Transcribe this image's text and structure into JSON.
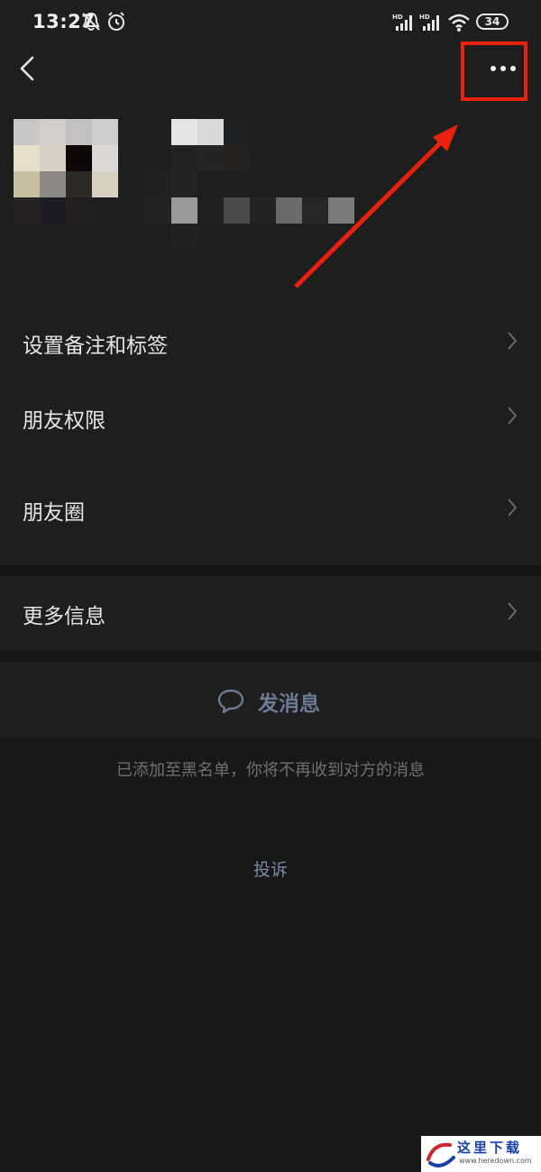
{
  "status_bar": {
    "time": "13:27",
    "battery": "34",
    "icons": [
      "mute-bell-icon",
      "alarm-icon",
      "hd-signal-icon",
      "hd-signal-icon",
      "wifi-icon",
      "battery-icon"
    ],
    "network_badge": "HD"
  },
  "header": {
    "back_icon": "chevron-left-icon",
    "more_icon": "more-dots-icon"
  },
  "annotation": {
    "color": "#e8220e"
  },
  "menu": {
    "items": [
      {
        "label": "设置备注和标签"
      },
      {
        "label": "朋友权限"
      },
      {
        "label": "朋友圈"
      },
      {
        "label": "更多信息"
      }
    ]
  },
  "actions": {
    "send_message": "发消息",
    "send_message_icon": "chat-bubble-icon"
  },
  "notice": {
    "blacklist": "已添加至黑名单，你将不再收到对方的消息"
  },
  "complain": {
    "label": "投诉"
  },
  "watermark": {
    "text": "这里下载",
    "sub": "www.heredown.com"
  },
  "colors": {
    "background": "#1e1e1e",
    "accent_link": "#6c7a93",
    "annotation_red": "#e8220e"
  }
}
